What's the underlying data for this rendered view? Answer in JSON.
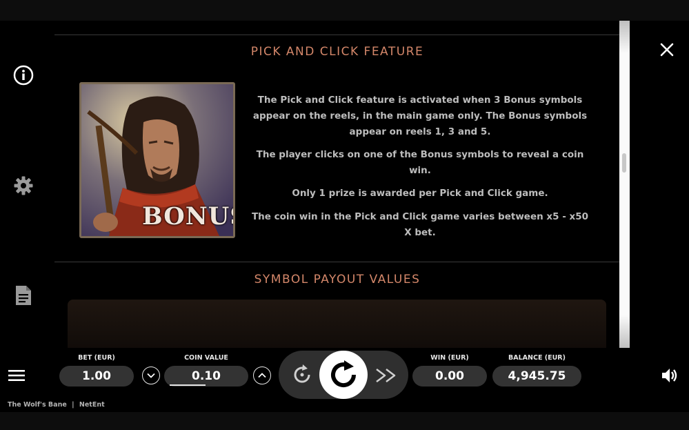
{
  "panel": {
    "pick_title": "PICK AND CLICK FEATURE",
    "bonus_label": "BONUS",
    "paragraphs": [
      "The Pick and Click feature is activated when 3 Bonus symbols appear on the reels, in the main game only. The Bonus symbols appear on reels 1, 3 and 5.",
      "The player clicks on one of the Bonus symbols to reveal a coin win.",
      "Only 1 prize is awarded per Pick and Click game.",
      "The coin win in the Pick and Click game varies between x5 - x50 X bet."
    ],
    "payout_title": "SYMBOL PAYOUT VALUES"
  },
  "sidebar": {
    "icons": [
      "info-icon",
      "gear-icon",
      "document-icon"
    ]
  },
  "controls": {
    "bet_label": "BET (EUR)",
    "bet_value": "1.00",
    "coin_label": "COIN VALUE",
    "coin_value": "0.10",
    "win_label": "WIN (EUR)",
    "win_value": "0.00",
    "balance_label": "BALANCE (EUR)",
    "balance_value": "4,945.75"
  },
  "footer": {
    "game_name": "The Wolf's Bane",
    "separator": "|",
    "provider": "NetEnt"
  },
  "colors": {
    "title_accent": "#d4876a",
    "text_gray": "#bdbdbd",
    "pill_bg": "#333333"
  }
}
